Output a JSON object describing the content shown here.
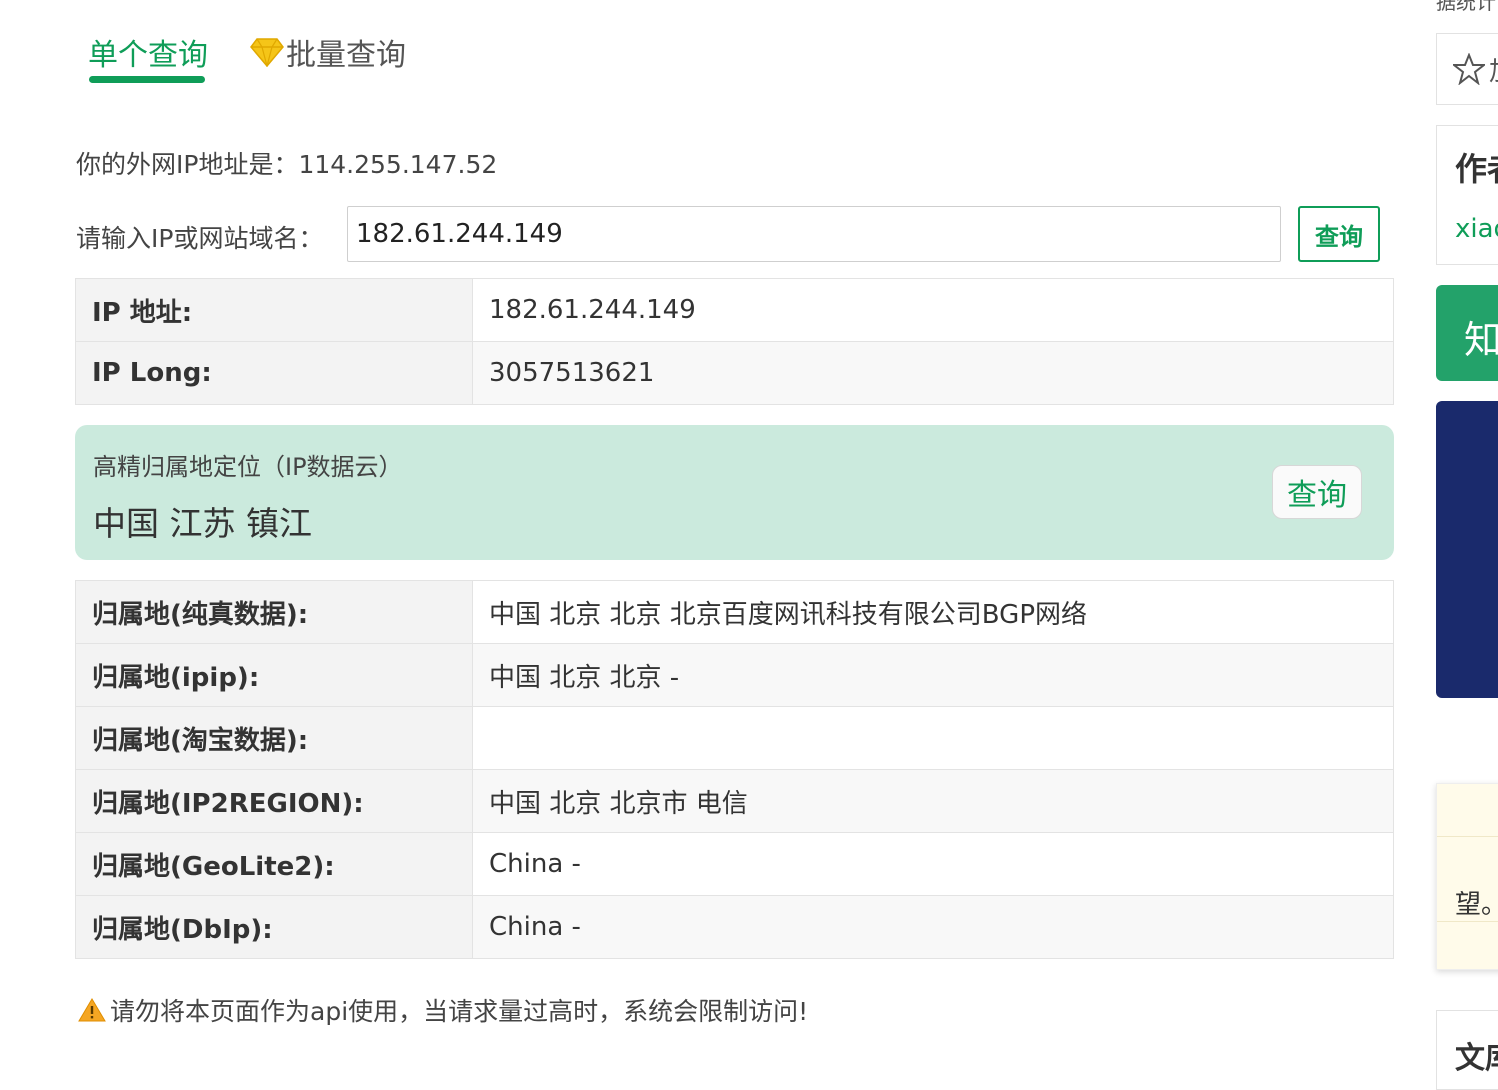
{
  "tabs": {
    "single": "单个查询",
    "batch": "批量查询"
  },
  "myip": {
    "label": "你的外网IP地址是：",
    "value": "114.255.147.52"
  },
  "query": {
    "label": "请输入IP或网站域名：",
    "input_value": "182.61.244.149",
    "button": "查询"
  },
  "basic_table": [
    {
      "key": "IP 地址:",
      "value": "182.61.244.149"
    },
    {
      "key": "IP Long:",
      "value": "3057513621"
    }
  ],
  "geo": {
    "title": "高精归属地定位（IP数据云）",
    "location": "中国 江苏 镇江",
    "button": "查询"
  },
  "region_table": [
    {
      "key": "归属地(纯真数据):",
      "value": "中国 北京 北京 北京百度网讯科技有限公司BGP网络"
    },
    {
      "key": "归属地(ipip):",
      "value": "中国 北京 北京 -"
    },
    {
      "key": "归属地(淘宝数据):",
      "value": ""
    },
    {
      "key": "归属地(IP2REGION):",
      "value": "中国 北京 北京市 电信"
    },
    {
      "key": "归属地(GeoLite2):",
      "value": "China -"
    },
    {
      "key": "归属地(DbIp):",
      "value": "China -"
    }
  ],
  "warning": "请勿将本页面作为api使用，当请求量过高时，系统会限制访问!",
  "sidebar": {
    "top_text": "据统计",
    "fav_label": "加",
    "author_heading": "作者",
    "author_name": "xiao",
    "green_text": "知",
    "note_text": "望。",
    "doc_heading": "文库"
  },
  "colors": {
    "accent": "#0f9d58",
    "geo_bg": "#cbeadd",
    "navy": "#1a2a6c"
  },
  "icons": {
    "batch_tab": "diamond-icon",
    "warning": "warning-icon",
    "favorite": "star-icon"
  }
}
